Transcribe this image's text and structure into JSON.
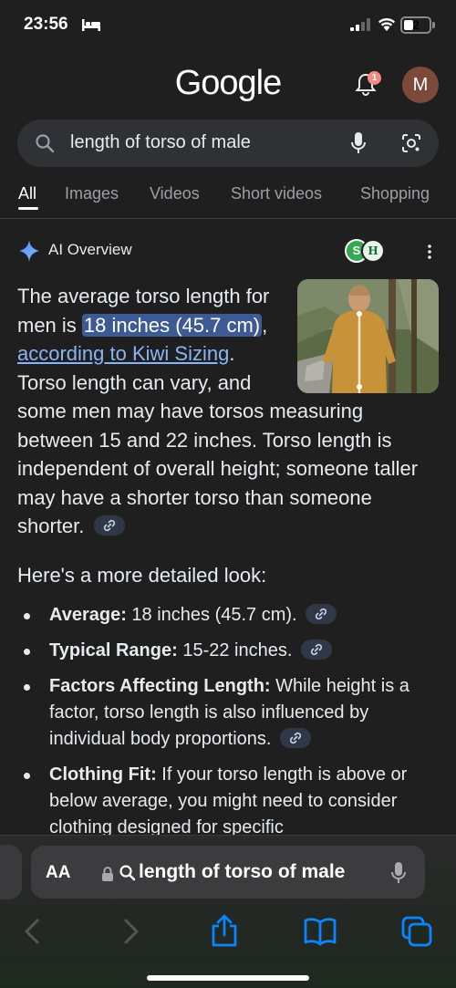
{
  "status_bar": {
    "time": "23:56",
    "battery": "2"
  },
  "header": {
    "logo": "Google",
    "notification_count": "1",
    "avatar_initial": "M"
  },
  "search": {
    "query": "length of torso of male"
  },
  "tabs": [
    {
      "label": "All",
      "active": true
    },
    {
      "label": "Images"
    },
    {
      "label": "Videos"
    },
    {
      "label": "Short videos"
    },
    {
      "label": "Shopping"
    }
  ],
  "ai_overview": {
    "title": "AI Overview",
    "favicons": [
      "S",
      "H"
    ],
    "intro_1": "The average torso length for men is ",
    "highlight": "18 inches (45.7 cm)",
    "intro_2": ", ",
    "source_link": "according to Kiwi Sizing",
    "intro_3": ". Torso length can vary, and some men may have torsos measuring between 15 and 22 inches. Torso length is independent of overall height; someone taller may have a shorter torso than someone shorter.",
    "detail_heading": "Here's a more detailed look:",
    "bullets": [
      {
        "term": "Average:",
        "text": " 18 inches (45.7 cm)."
      },
      {
        "term": "Typical Range:",
        "text": " 15-22 inches."
      },
      {
        "term": "Factors Affecting Length:",
        "text": " While height is a factor, torso length is also influenced by individual body proportions."
      },
      {
        "term": "Clothing Fit:",
        "text": " If your torso length is above or below average, you might need to consider clothing designed for specific"
      }
    ]
  },
  "browser": {
    "aa": "AA",
    "address": "length of torso of male"
  },
  "colors": {
    "accent_link": "#8ab4f8",
    "highlight_bg": "#3d5a94",
    "safari_blue": "#0a84ff"
  }
}
